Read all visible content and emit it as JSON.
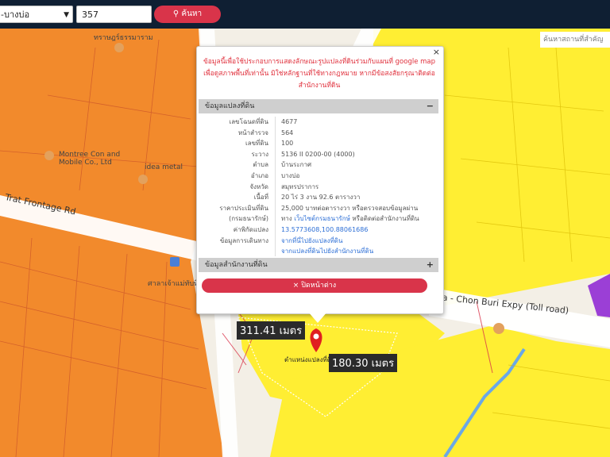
{
  "toolbar": {
    "district_select": "-บางบ่อ",
    "search_value": "357",
    "search_button": "ค้นหา"
  },
  "map": {
    "search_place_placeholder": "ค้นหาสถานที่สำคัญ",
    "labels": {
      "road_top": "ทราษฎร์ธรรมาราม",
      "montree": "Montree Con and Mobile Co., Ltd",
      "idea": "idea metal",
      "frontage": "Trat Frontage Rd",
      "expressway": "ra - Chon Buri Expy (Toll road)",
      "pin_label": "ตำแหน่งแปลงที่ดิน",
      "nearby": "ศาลาเจ้าแม่ทับทิม"
    },
    "distances": [
      "311.41 เมตร",
      "180.30 เมตร"
    ]
  },
  "popup": {
    "close_symbol": "×",
    "notice": "ข้อมูลนี้เพื่อใช้ประกอบการแสดงลักษณะรูปแปลงที่ดินร่วมกับแผนที่ google map เพื่อดูสภาพพื้นที่เท่านั้น มิใช่หลักฐานที่ใช้ทางกฎหมาย หากมีข้อสงสัยกรุณาติดต่อสำนักงานที่ดิน",
    "land_section": "ข้อมูลแปลงที่ดิน",
    "land_section_symbol": "−",
    "rows": [
      {
        "key": "เลขโฉนดที่ดิน",
        "value": "4677"
      },
      {
        "key": "หน้าสำรวจ",
        "value": "564"
      },
      {
        "key": "เลขที่ดิน",
        "value": "100"
      },
      {
        "key": "ระวาง",
        "value": "5136 II 0200-00 (4000)"
      },
      {
        "key": "ตำบล",
        "value": "บ้านระกาศ"
      },
      {
        "key": "อำเภอ",
        "value": "บางบ่อ"
      },
      {
        "key": "จังหวัด",
        "value": "สมุทรปราการ"
      },
      {
        "key": "เนื้อที่",
        "value": "20 ไร่ 3 งาน 92.6 ตารางวา"
      },
      {
        "key": "ราคาประเมินที่ดิน",
        "value": "25,000 บาทต่อตารางวา หรือตรวจสอบข้อมูลผ่าน"
      },
      {
        "key": "(กรมธนารักษ์)",
        "value_pre": "ทาง ",
        "value_link": "เว็บไซต์กรมธนารักษ์",
        "value_post": " หรือติดต่อสำนักงานที่ดิน"
      },
      {
        "key": "ค่าพิกัดแปลง",
        "link": "13.5773608,100.88061686"
      },
      {
        "key": "ข้อมูลการเดินทาง",
        "link": "จากที่นี่ไปยังแปลงที่ดิน"
      },
      {
        "key": "",
        "link": "จากแปลงที่ดินไปยังสำนักงานที่ดิน"
      }
    ],
    "office_section": "ข้อมูลสำนักงานที่ดิน",
    "office_section_symbol": "+",
    "close_button": "ปิดหน้าต่าง",
    "close_button_icon": "×"
  },
  "colors": {
    "orange_zone": "#f28a2c",
    "yellow_zone": "#ffee33",
    "purple_zone": "#9b3fd6",
    "accent_red": "#d9344a",
    "topbar": "#0f1f33"
  }
}
